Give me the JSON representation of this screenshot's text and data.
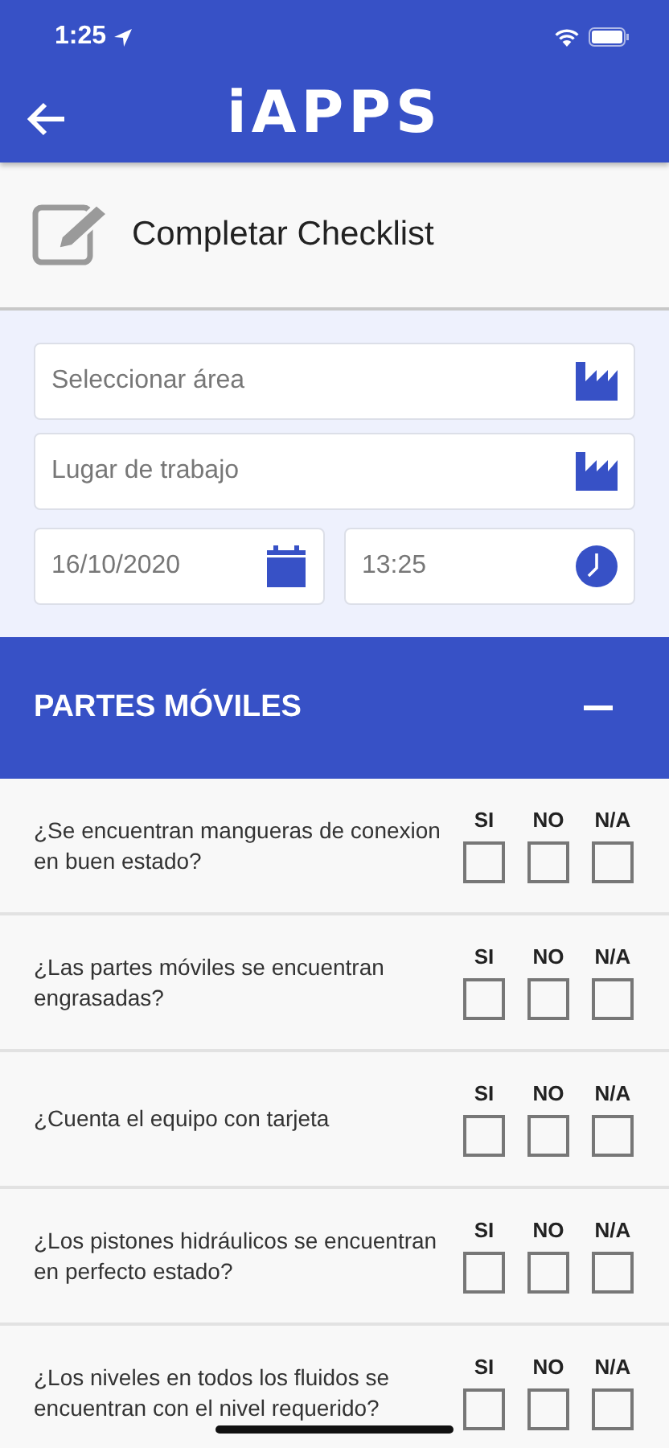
{
  "status_bar": {
    "time": "1:25"
  },
  "header": {
    "logo": "iAPPS"
  },
  "page_title": "Completar Checklist",
  "form": {
    "fields": [
      {
        "kind": "select",
        "placeholder": "Seleccionar área"
      },
      {
        "kind": "select",
        "placeholder": "Lugar de trabajo"
      }
    ],
    "date": {
      "value": "16/10/2020"
    },
    "time": {
      "value": "13:25"
    }
  },
  "section": {
    "title": "PARTES MÓVILES",
    "expanded": true
  },
  "questions": [
    {
      "text": "¿Se encuentran mangueras de conexion en buen estado?",
      "options": [
        {
          "label": "SI",
          "checked": false
        },
        {
          "label": "NO",
          "checked": false
        },
        {
          "label": "N/A",
          "checked": false
        }
      ]
    },
    {
      "text": "¿Las partes móviles se encuentran engrasadas?",
      "options": [
        {
          "label": "SI",
          "checked": false
        },
        {
          "label": "NO",
          "checked": false
        },
        {
          "label": "N/A",
          "checked": false
        }
      ]
    },
    {
      "text": "¿Cuenta el equipo con tarjeta",
      "options": [
        {
          "label": "SI",
          "checked": false
        },
        {
          "label": "NO",
          "checked": false
        },
        {
          "label": "N/A",
          "checked": false
        }
      ]
    },
    {
      "text": "¿Los pistones hidráulicos se encuentran en perfecto estado?",
      "options": [
        {
          "label": "SI",
          "checked": false
        },
        {
          "label": "NO",
          "checked": false
        },
        {
          "label": "N/A",
          "checked": false
        }
      ]
    },
    {
      "text": "¿Los niveles en todos los fluidos se encuentran con el nivel requerido?",
      "options": [
        {
          "label": "SI",
          "checked": false
        },
        {
          "label": "NO",
          "checked": false
        },
        {
          "label": "N/A",
          "checked": false
        }
      ]
    }
  ]
}
